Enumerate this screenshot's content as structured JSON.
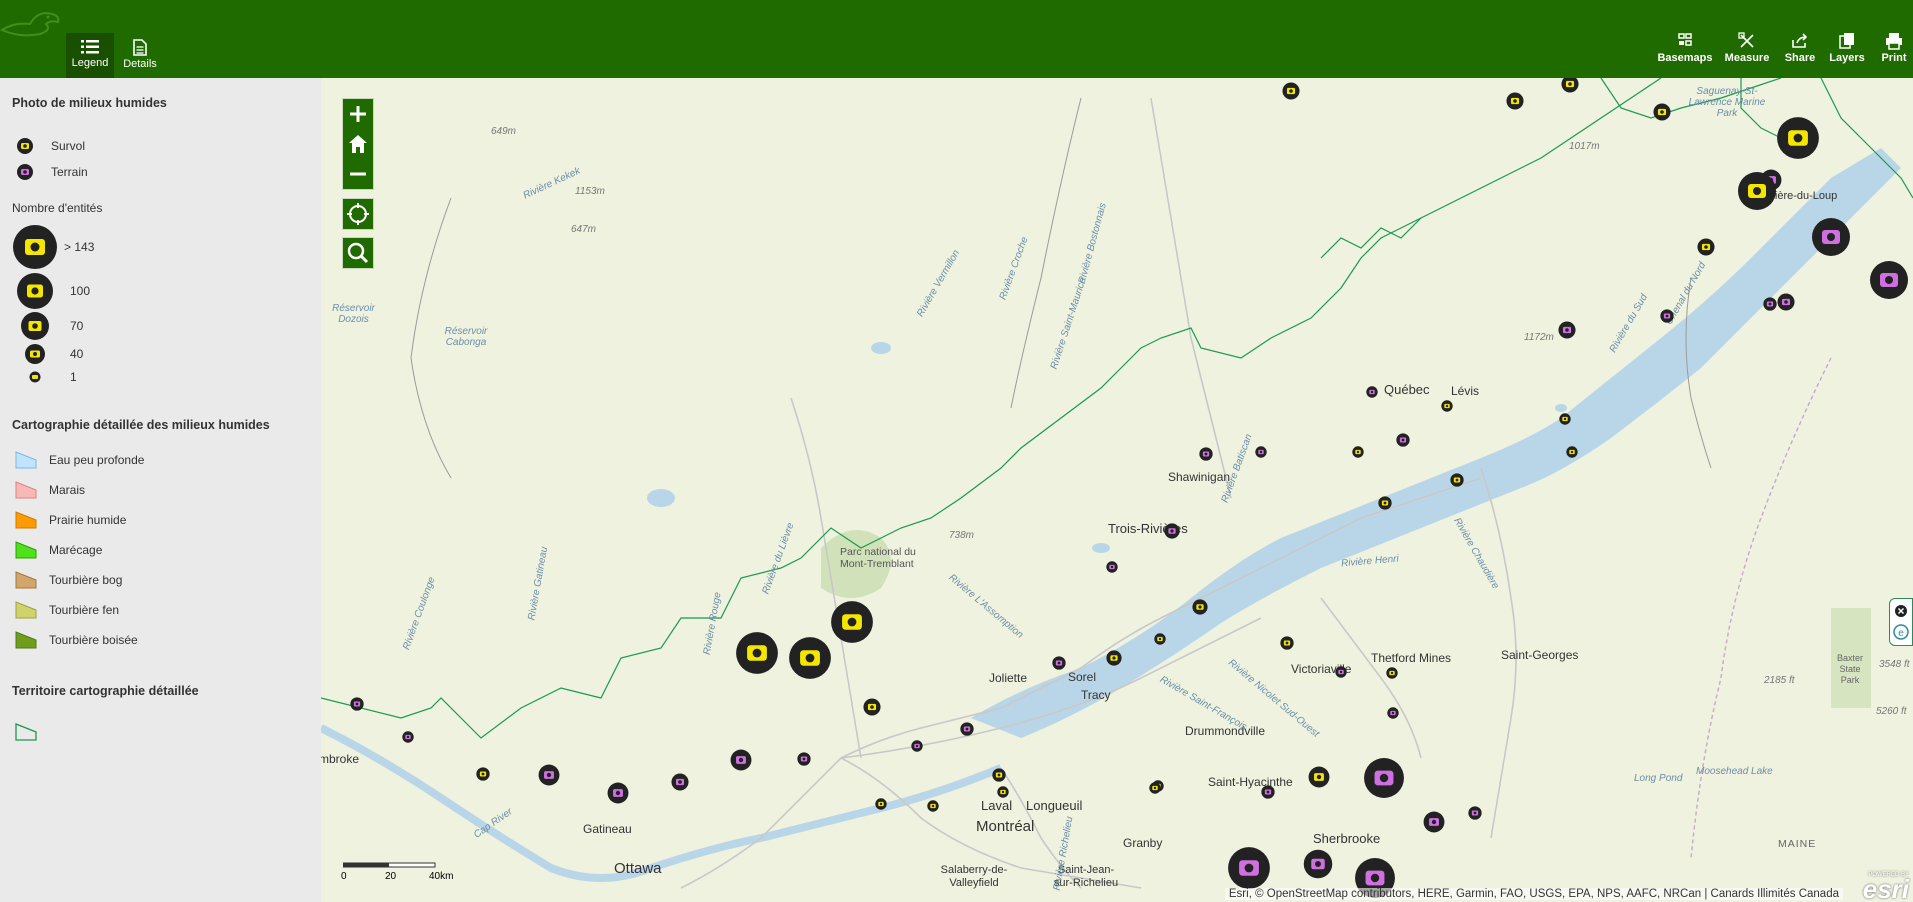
{
  "header": {
    "tabs": [
      {
        "label": "Legend",
        "icon": "list-icon"
      },
      {
        "label": "Details",
        "icon": "document-icon"
      }
    ],
    "tools": [
      {
        "label": "Basemaps",
        "icon": "basemap-grid-icon"
      },
      {
        "label": "Measure",
        "icon": "measure-ruler-icon"
      },
      {
        "label": "Share",
        "icon": "share-icon"
      },
      {
        "label": "Layers",
        "icon": "layers-icon"
      },
      {
        "label": "Print",
        "icon": "print-icon"
      }
    ],
    "colors": {
      "bar": "#206b00",
      "active_tab": "#184f00"
    }
  },
  "legend": {
    "section1_title": "Photo de milieux humides",
    "photo_types": [
      {
        "label": "Survol",
        "color": "#f5e600"
      },
      {
        "label": "Terrain",
        "color": "#d070e0"
      }
    ],
    "count_title": "Nombre d'entités",
    "counts": [
      "> 143",
      "100",
      "70",
      "40",
      "1"
    ],
    "section2_title": "Cartographie détaillée des milieux humides",
    "classes": [
      {
        "label": "Eau peu profonde",
        "color": "#bfe4ff",
        "border": "#7fb7e0"
      },
      {
        "label": "Marais",
        "color": "#f9b8b8",
        "border": "#e08080"
      },
      {
        "label": "Prairie humide",
        "color": "#ff9a00",
        "border": "#d07a00"
      },
      {
        "label": "Marécage",
        "color": "#4ee11c",
        "border": "#2ca000"
      },
      {
        "label": "Tourbière bog",
        "color": "#d2a66a",
        "border": "#a07840"
      },
      {
        "label": "Tourbière fen",
        "color": "#cfd36b",
        "border": "#a0a040"
      },
      {
        "label": "Tourbière boisée",
        "color": "#6f9e1f",
        "border": "#4e7a10"
      }
    ],
    "section3_title": "Territoire cartographie détaillée"
  },
  "map": {
    "places": [
      {
        "name": "Québec",
        "cls": "city"
      },
      {
        "name": "Lévis",
        "cls": "town"
      },
      {
        "name": "Shawinigan",
        "cls": "town"
      },
      {
        "name": "Trois-Rivières",
        "cls": "city"
      },
      {
        "name": "Victoriaville",
        "cls": "town"
      },
      {
        "name": "Thetford Mines",
        "cls": "town"
      },
      {
        "name": "Saint-Georges",
        "cls": "town"
      },
      {
        "name": "Joliette",
        "cls": "town"
      },
      {
        "name": "Sorel",
        "cls": "town"
      },
      {
        "name": "Tracy",
        "cls": "town"
      },
      {
        "name": "Drummondville",
        "cls": "town"
      },
      {
        "name": "Saint-Hyacinthe",
        "cls": "town"
      },
      {
        "name": "Laval",
        "cls": "city"
      },
      {
        "name": "Longueuil",
        "cls": "city"
      },
      {
        "name": "Montréal",
        "cls": "bigcity"
      },
      {
        "name": "Gatineau",
        "cls": "town"
      },
      {
        "name": "Ottawa",
        "cls": "bigcity"
      },
      {
        "name": "Granby",
        "cls": "town"
      },
      {
        "name": "Sherbrooke",
        "cls": "city"
      },
      {
        "name": "Salaberry-de-Valleyfield",
        "cls": "town"
      },
      {
        "name": "Saint-Jean-sur-Richelieu",
        "cls": "town"
      },
      {
        "name": "mbroke",
        "cls": "town"
      },
      {
        "name": "Parc national du Mont-Tremblant",
        "cls": "park"
      },
      {
        "name": "MAINE",
        "cls": "region"
      },
      {
        "name": "Baxter State Park",
        "cls": "park"
      }
    ],
    "water_labels": [
      "Rivière Kekek",
      "Réservoir Dozois",
      "Réservoir Cabonga",
      "Rivière Vermillon",
      "Rivière Croche",
      "Rivière Saint-Maurice",
      "Rivière Bostonnais",
      "Rivière Gatineau",
      "Rivière Coulonge",
      "Rivière Rouge",
      "Rivière du Lièvre",
      "Rivière L'Assomption",
      "Rivière Batiscan",
      "Rivière Henri",
      "Rivière Chaudière",
      "Rivière Saint-François",
      "Rivière Nicolet Sud-Ouest",
      "Rivière du Sud",
      "Chenal du Nord",
      "Long Pond",
      "Moosehead Lake",
      "Saguenay-St-Lawrence Marine Park",
      "Rivière-du-Loup",
      "Cap River",
      "Rivière Richelieu"
    ],
    "elevations": [
      "649m",
      "1153m",
      "647m",
      "738m",
      "1172m",
      "1017m",
      "2185 ft",
      "3548 ft",
      "5260 ft"
    ],
    "scale": {
      "ticks": [
        "0",
        "20",
        "40km"
      ]
    },
    "attribution": "Esri, © OpenStreetMap contributors, HERE, Garmin, FAO, USGS, EPA, NPS, AAFC, NRCan | Canards Illimités Canada",
    "esri_logo": "esri",
    "powered_by": "POWERED BY"
  }
}
